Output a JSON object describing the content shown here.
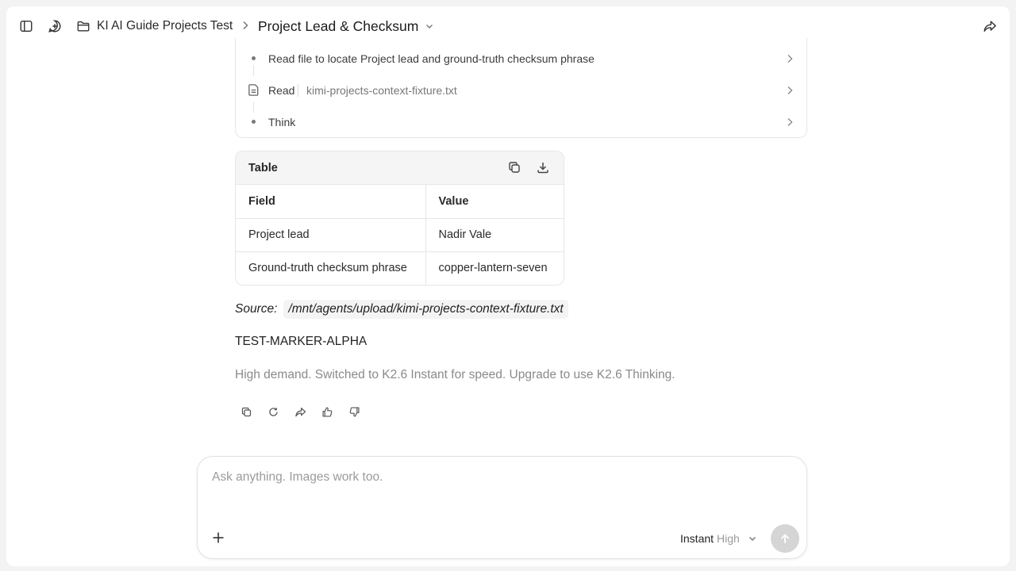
{
  "header": {
    "project_name": "KI AI Guide Projects Test",
    "chat_title": "Project Lead & Checksum"
  },
  "steps": {
    "items": [
      {
        "label": "Read file to locate Project lead and ground-truth checksum phrase"
      },
      {
        "label": "Read",
        "file": "kimi-projects-context-fixture.txt"
      },
      {
        "label": "Think"
      }
    ]
  },
  "table": {
    "title": "Table",
    "columns": [
      "Field",
      "Value"
    ],
    "rows": [
      [
        "Project lead",
        "Nadir Vale"
      ],
      [
        "Ground-truth checksum phrase",
        "copper-lantern-seven"
      ]
    ]
  },
  "message": {
    "source_label": "Source:",
    "source_path": "/mnt/agents/upload/kimi-projects-context-fixture.txt",
    "marker": "TEST-MARKER-ALPHA",
    "notice": "High demand. Switched to K2.6 Instant for speed. Upgrade to use K2.6 Thinking."
  },
  "composer": {
    "placeholder": "Ask anything. Images work too.",
    "value": "",
    "mode": "Instant",
    "level": "High"
  },
  "colors": {
    "background": "#f3f3f3",
    "surface": "#ffffff",
    "muted_text": "#8a8a8a",
    "border": "#e6e6e6",
    "send_disabled": "#d5d5d5"
  },
  "icons": {
    "sidebar_toggle": "sidebar-toggle-icon",
    "new_chat": "new-chat-icon",
    "folder": "folder-icon",
    "share": "share-icon",
    "copy": "copy-icon",
    "download": "download-icon",
    "regenerate": "regenerate-icon",
    "thumbs_up": "thumbs-up-icon",
    "thumbs_down": "thumbs-down-icon",
    "plus": "plus-icon",
    "send": "arrow-up-icon"
  }
}
